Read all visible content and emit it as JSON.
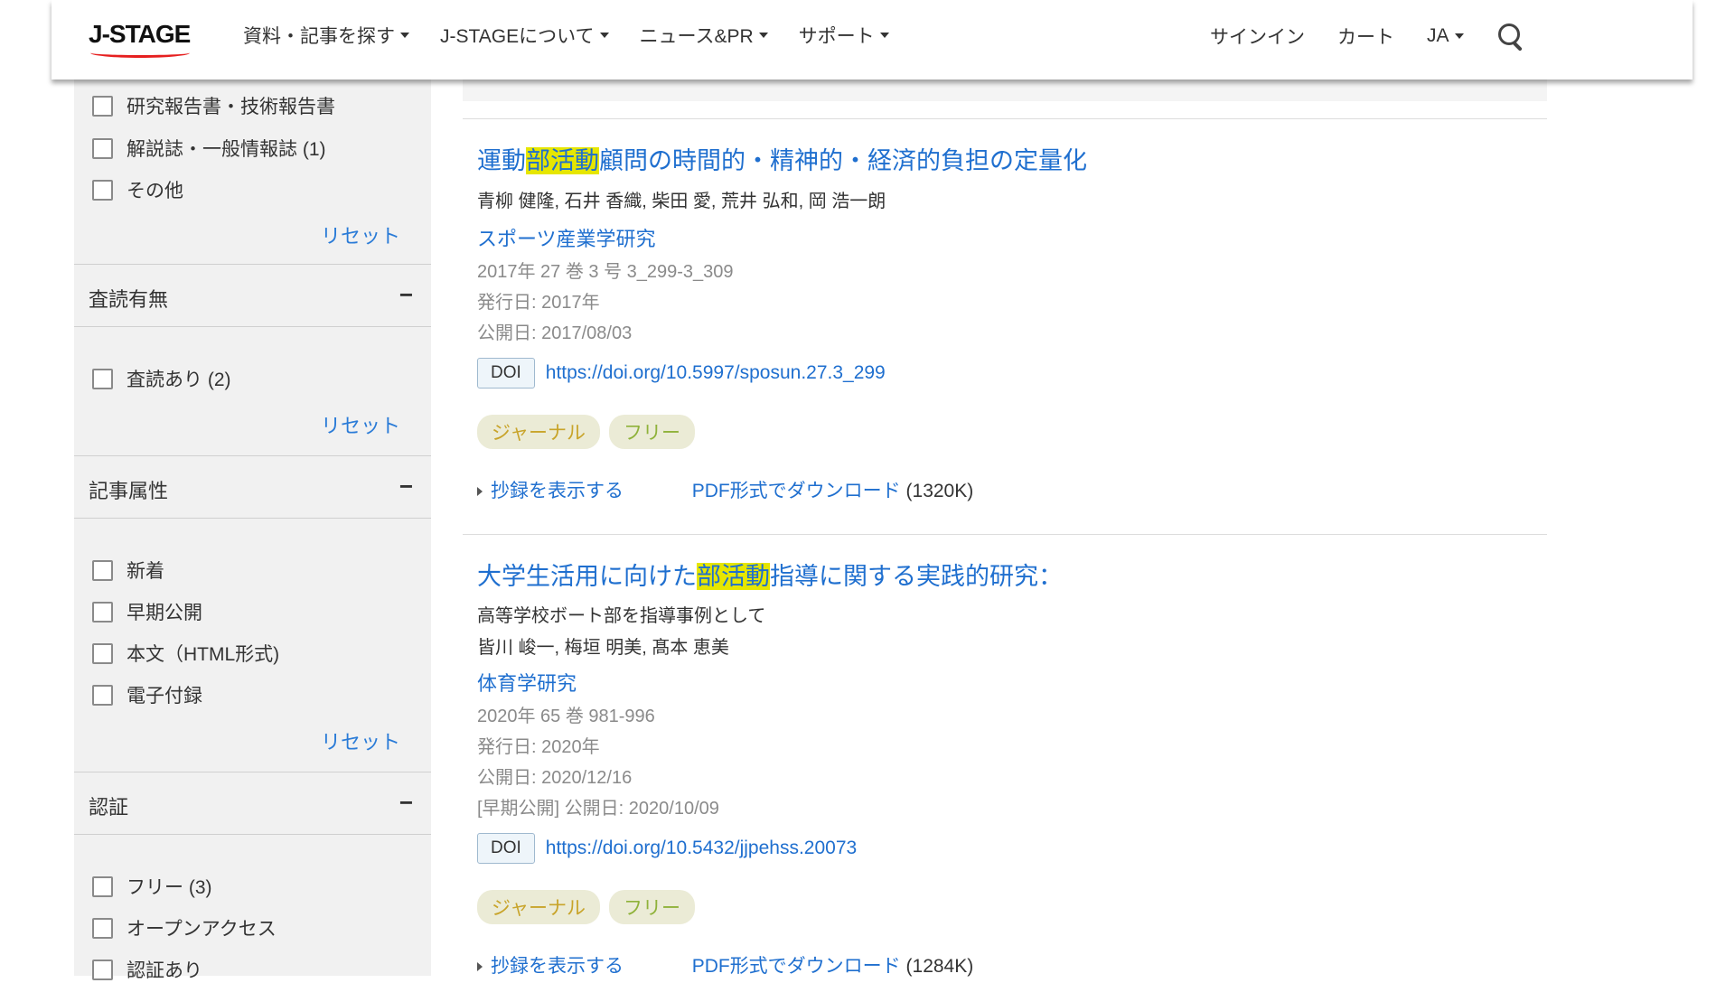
{
  "header": {
    "logo": "J-STAGE",
    "nav": [
      {
        "label": "資料・記事を探す"
      },
      {
        "label": "J-STAGEについて"
      },
      {
        "label": "ニュース&PR"
      },
      {
        "label": "サポート"
      }
    ],
    "signin": "サインイン",
    "cart": "カート",
    "language": "JA"
  },
  "sidebar": {
    "type_items": [
      {
        "label": "研究報告書・技術報告書"
      },
      {
        "label": "解説誌・一般情報誌 (1)"
      },
      {
        "label": "その他"
      }
    ],
    "reset_label": "リセット",
    "facets": {
      "peer_review": {
        "title": "査読有無",
        "toggle": "−",
        "items": [
          {
            "label": "査読あり (2)"
          }
        ]
      },
      "attributes": {
        "title": "記事属性",
        "toggle": "−",
        "items": [
          {
            "label": "新着"
          },
          {
            "label": "早期公開"
          },
          {
            "label": "本文（HTML形式)"
          },
          {
            "label": "電子付録"
          }
        ]
      },
      "auth": {
        "title": "認証",
        "toggle": "−",
        "items": [
          {
            "label": "フリー (3)"
          },
          {
            "label": "オープンアクセス"
          },
          {
            "label": "認証あり"
          }
        ]
      }
    }
  },
  "results": [
    {
      "title_pre": "運動",
      "title_hl": "部活動",
      "title_post": "顧問の時間的・精神的・経済的負担の定量化",
      "authors": "青柳 健隆, 石井 香織, 柴田 愛, 荒井 弘和, 岡 浩一朗",
      "journal": "スポーツ産業学研究",
      "volume": "2017年 27 巻 3 号 3_299-3_309",
      "issued": "発行日: 2017年",
      "released": "公開日: 2017/08/03",
      "doi_label": "DOI",
      "doi_url": "https://doi.org/10.5997/sposun.27.3_299",
      "tags": [
        "ジャーナル",
        "フリー"
      ],
      "abstract_label": "抄録を表示する",
      "pdf_label": "PDF形式でダウンロード",
      "pdf_size": "(1320K)"
    },
    {
      "title_pre": "大学生活用に向けた",
      "title_hl": "部活動",
      "title_post": "指導に関する実践的研究：",
      "subtitle": "高等学校ボート部を指導事例として",
      "authors": "皆川 峻一, 梅垣 明美, 髙本 恵美",
      "journal": "体育学研究",
      "volume": "2020年 65 巻 981-996",
      "issued": "発行日: 2020年",
      "released": "公開日: 2020/12/16",
      "early": "[早期公開] 公開日: 2020/10/09",
      "doi_label": "DOI",
      "doi_url": "https://doi.org/10.5432/jjpehss.20073",
      "tags": [
        "ジャーナル",
        "フリー"
      ],
      "abstract_label": "抄録を表示する",
      "pdf_label": "PDF形式でダウンロード",
      "pdf_size": "(1284K)"
    }
  ]
}
